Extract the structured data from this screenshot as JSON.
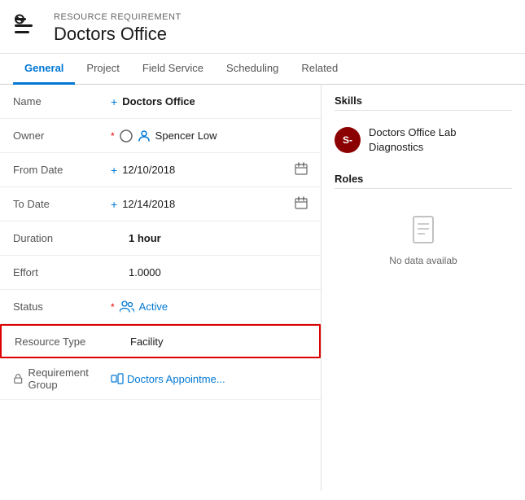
{
  "header": {
    "subtitle": "RESOURCE REQUIREMENT",
    "title": "Doctors Office"
  },
  "nav": {
    "tabs": [
      {
        "label": "General",
        "active": true
      },
      {
        "label": "Project",
        "active": false
      },
      {
        "label": "Field Service",
        "active": false
      },
      {
        "label": "Scheduling",
        "active": false
      },
      {
        "label": "Related",
        "active": false
      }
    ]
  },
  "form": {
    "fields": [
      {
        "label": "Name",
        "required_marker": "+",
        "value": "Doctors Office",
        "type": "text",
        "bold": true
      },
      {
        "label": "Owner",
        "required_marker": "*",
        "value": "Spencer Low",
        "type": "owner"
      },
      {
        "label": "From Date",
        "required_marker": "+",
        "value": "12/10/2018",
        "type": "date"
      },
      {
        "label": "To Date",
        "required_marker": "+",
        "value": "12/14/2018",
        "type": "date"
      },
      {
        "label": "Duration",
        "required_marker": "",
        "value": "1 hour",
        "type": "text",
        "bold": true
      },
      {
        "label": "Effort",
        "required_marker": "",
        "value": "1.0000",
        "type": "text"
      },
      {
        "label": "Status",
        "required_marker": "*",
        "value": "Active",
        "type": "status"
      },
      {
        "label": "Resource Type",
        "required_marker": "",
        "value": "Facility",
        "type": "text",
        "highlighted": true
      }
    ],
    "req_group": {
      "label": "Requirement Group",
      "value": "Doctors Appointme..."
    }
  },
  "skills": {
    "title": "Skills",
    "item": {
      "avatar_initials": "S-",
      "avatar_bg": "#8b0000",
      "name": "Doctors Office Lab Diagnostics"
    }
  },
  "roles": {
    "title": "Roles",
    "no_data_text": "No data availab"
  }
}
